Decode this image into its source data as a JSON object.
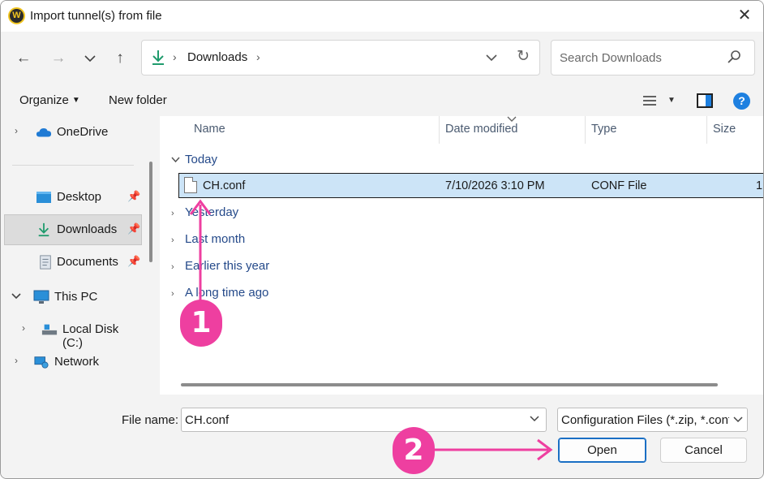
{
  "window": {
    "title": "Import tunnel(s) from file",
    "app_icon_glyph": "W"
  },
  "nav": {
    "address": {
      "path": [
        "Downloads"
      ]
    },
    "search": {
      "placeholder": "Search Downloads"
    }
  },
  "commands": {
    "organize": "Organize",
    "new_folder": "New folder"
  },
  "sidebar": {
    "items": [
      {
        "label": "OneDrive",
        "icon": "onedrive-icon",
        "expandable": true
      },
      {
        "label": "Desktop",
        "icon": "desktop-icon",
        "pinned": true
      },
      {
        "label": "Downloads",
        "icon": "downloads-icon",
        "pinned": true,
        "selected": true
      },
      {
        "label": "Documents",
        "icon": "documents-icon",
        "pinned": true
      },
      {
        "label": "This PC",
        "icon": "this-pc-icon",
        "expanded": true
      },
      {
        "label": "Local Disk (C:)",
        "icon": "local-disk-icon",
        "expandable": true
      },
      {
        "label": "Network",
        "icon": "network-icon",
        "expandable": true
      }
    ]
  },
  "filelist": {
    "columns": [
      "Name",
      "Date modified",
      "Type",
      "Size"
    ],
    "groups": [
      "Today",
      "Yesterday",
      "Last month",
      "Earlier this year",
      "A long time ago"
    ],
    "files": [
      {
        "name": "CH.conf",
        "date": "7/10/2026 3:10 PM",
        "type": "CONF File",
        "size": "1"
      }
    ]
  },
  "bottom": {
    "file_name_label": "File name:",
    "file_name_value": "CH.conf",
    "file_type_value": "Configuration Files (*.zip, *.conf",
    "open_label": "Open",
    "cancel_label": "Cancel"
  },
  "annotations": {
    "step1": "1",
    "step2": "2",
    "color": "#ee3fa0"
  },
  "colors": {
    "accent": "#1e80e0",
    "selection": "#cce4f7",
    "group_text": "#254a8a"
  }
}
